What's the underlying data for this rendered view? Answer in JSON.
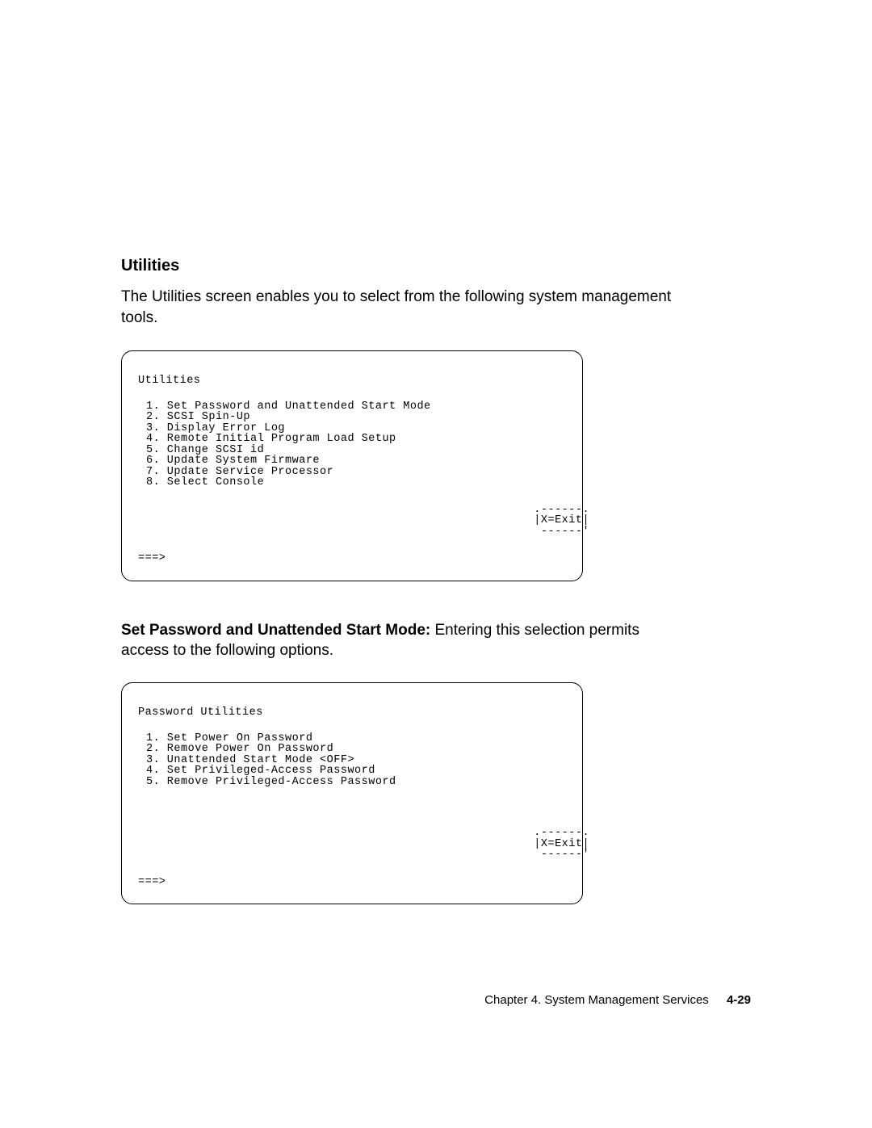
{
  "section1": {
    "heading": "Utilities",
    "intro": "The Utilities screen enables you to select from the following system management tools.",
    "box": {
      "title": "Utilities",
      "items": {
        "i1": "1. Set Password and Unattended Start Mode",
        "i2": "2. SCSI Spin-Up",
        "i3": "3. Display Error Log",
        "i4": "4. Remote Initial Program Load Setup",
        "i5": "5. Change SCSI id",
        "i6": "6. Update System Firmware",
        "i7": "7. Update Service Processor",
        "i8": "8. Select Console"
      },
      "exit_top": "                                                         .------.",
      "exit_mid": "                                                         |X=Exit|",
      "exit_bottom": "                                                          ------'",
      "prompt": "===>"
    }
  },
  "section2": {
    "heading": "Set Password and Unattended Start Mode:",
    "run_in": "   Entering this selection permits access to the following options.",
    "box": {
      "title": "Password Utilities",
      "items": {
        "i1": "1. Set Power On Password",
        "i2": "2. Remove Power On Password",
        "i3": "3. Unattended Start Mode <OFF>",
        "i4": "4. Set Privileged-Access Password",
        "i5": "5. Remove Privileged-Access Password"
      },
      "exit_top": "                                                         .------.",
      "exit_mid": "                                                         |X=Exit|",
      "exit_bottom": "                                                          ------'",
      "prompt": "===>"
    }
  },
  "footer": {
    "chapter": "Chapter 4.  System Management Services",
    "page": "4-29"
  }
}
